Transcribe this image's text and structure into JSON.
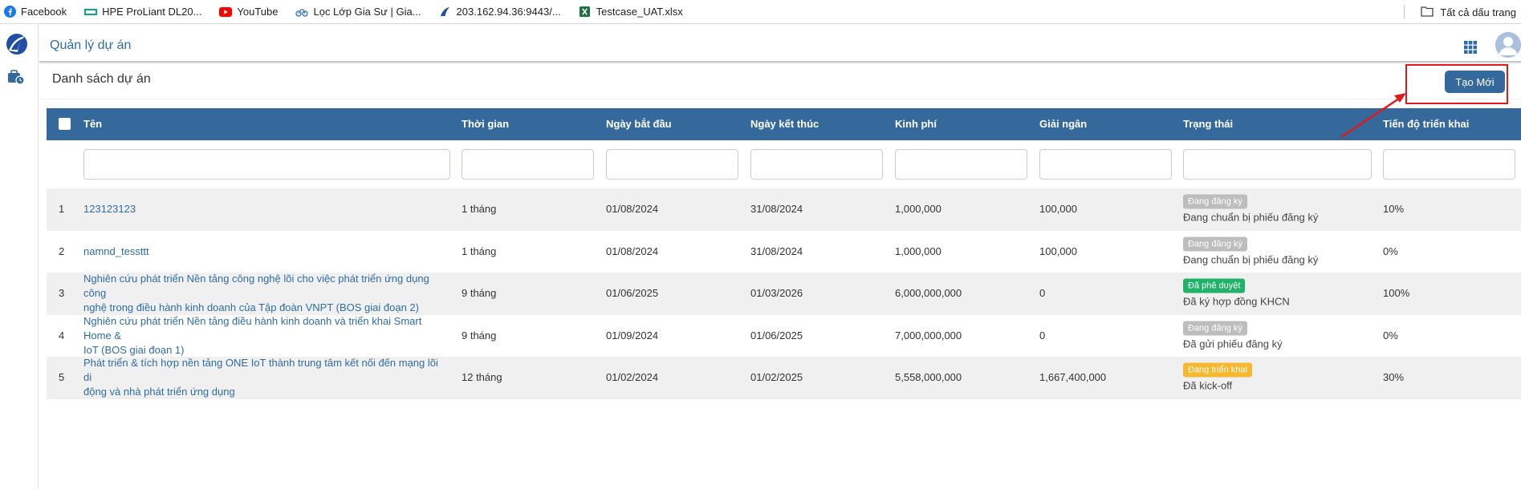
{
  "bookmarks": [
    {
      "label": "Facebook",
      "icon": "facebook-icon"
    },
    {
      "label": "HPE ProLiant DL20...",
      "icon": "hpe-icon"
    },
    {
      "label": "YouTube",
      "icon": "youtube-icon"
    },
    {
      "label": "Lọc Lớp Gia Sư | Gia...",
      "icon": "bike-icon"
    },
    {
      "label": "203.162.94.36:9443/...",
      "icon": "vnpt-icon"
    },
    {
      "label": "Testcase_UAT.xlsx",
      "icon": "excel-icon"
    }
  ],
  "bookmarks_right": {
    "label": "Tất cả dấu trang"
  },
  "app": {
    "title": "Quản lý dự án"
  },
  "page": {
    "heading": "Danh sách dự án",
    "new_button": "Tạo Mới"
  },
  "table": {
    "columns": [
      "Tên",
      "Thời gian",
      "Ngày bắt đầu",
      "Ngày kết thúc",
      "Kinh phí",
      "Giải ngân",
      "Trạng thái",
      "Tiến độ triển khai"
    ],
    "rows": [
      {
        "no": "1",
        "name": [
          "123123123"
        ],
        "duration": "1 tháng",
        "start": "01/08/2024",
        "end": "31/08/2024",
        "budget": "1,000,000",
        "disbursed": "100,000",
        "status": "Đang đăng ký",
        "status_color": "#bdbdbd",
        "status_detail": "Đang chuẩn bị phiếu đăng ký",
        "progress": "10%"
      },
      {
        "no": "2",
        "name": [
          "namnd_tessttt"
        ],
        "duration": "1 tháng",
        "start": "01/08/2024",
        "end": "31/08/2024",
        "budget": "1,000,000",
        "disbursed": "100,000",
        "status": "Đang đăng ký",
        "status_color": "#bdbdbd",
        "status_detail": "Đang chuẩn bị phiếu đăng ký",
        "progress": "0%"
      },
      {
        "no": "3",
        "name": [
          "Nghiên cứu phát triển Nền tảng công nghệ lõi cho việc phát triển ứng dụng công",
          "nghệ trong điều hành kinh doanh của Tập đoàn VNPT (BOS giai đoạn 2)"
        ],
        "duration": "9 tháng",
        "start": "01/06/2025",
        "end": "01/03/2026",
        "budget": "6,000,000,000",
        "disbursed": "0",
        "status": "Đã phê duyệt",
        "status_color": "#21b26a",
        "status_detail": "Đã ký hợp đồng KHCN",
        "progress": "100%"
      },
      {
        "no": "4",
        "name": [
          "Nghiên cứu phát triển Nền tảng điều hành kinh doanh và triển khai Smart Home &",
          "IoT (BOS giai đoạn 1)"
        ],
        "duration": "9 tháng",
        "start": "01/09/2024",
        "end": "01/06/2025",
        "budget": "7,000,000,000",
        "disbursed": "0",
        "status": "Đang đăng ký",
        "status_color": "#bdbdbd",
        "status_detail": "Đã gửi phiếu đăng ký",
        "progress": "0%"
      },
      {
        "no": "5",
        "name": [
          "Phát triển & tích hợp nền tảng ONE IoT thành trung tâm kết nối đến mạng lõi di",
          "động và nhà phát triển ứng dụng"
        ],
        "duration": "12 tháng",
        "start": "01/02/2024",
        "end": "01/02/2025",
        "budget": "5,558,000,000",
        "disbursed": "1,667,400,000",
        "status": "Đang triển khai",
        "status_color": "#f5b82e",
        "status_detail": "Đã kick-off",
        "progress": "30%"
      }
    ]
  },
  "colors": {
    "header": "#35699c",
    "link": "#2e6da4",
    "highlight": "#e0191c"
  }
}
